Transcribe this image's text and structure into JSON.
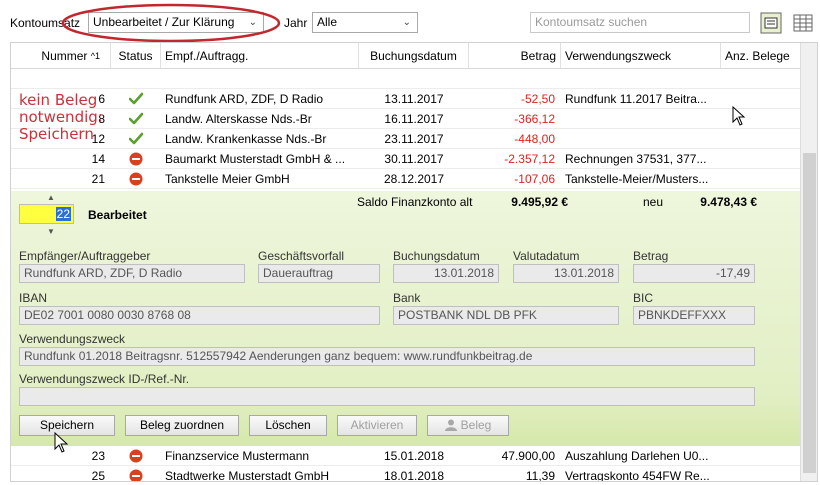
{
  "toolbar": {
    "kontoumsatz_label": "Kontoumsatz",
    "kontoumsatz_value": "Unbearbeitet / Zur Klärung",
    "jahr_label": "Jahr",
    "jahr_value": "Alle",
    "search_placeholder": "Kontoumsatz suchen"
  },
  "columns": {
    "nummer": "Nummer",
    "sort_indicator": "^1",
    "status": "Status",
    "empf": "Empf./Auftragg.",
    "datum": "Buchungsdatum",
    "betrag": "Betrag",
    "zweck": "Verwendungszweck",
    "belege": "Anz. Belege"
  },
  "rows_top": [
    {
      "nummer": "6",
      "status": "ok",
      "empf": "Rundfunk ARD, ZDF, D Radio",
      "datum": "13.11.2017",
      "betrag": "-52,50",
      "zweck": "Rundfunk 11.2017 Beitra..."
    },
    {
      "nummer": "8",
      "status": "ok",
      "empf": "Landw. Alterskasse Nds.-Br",
      "datum": "16.11.2017",
      "betrag": "-366,12",
      "zweck": ""
    },
    {
      "nummer": "12",
      "status": "ok",
      "empf": "Landw. Krankenkasse Nds.-Br",
      "datum": "23.11.2017",
      "betrag": "-448,00",
      "zweck": ""
    },
    {
      "nummer": "14",
      "status": "no",
      "empf": "Baumarkt Musterstadt GmbH & ...",
      "datum": "30.11.2017",
      "betrag": "-2.357,12",
      "zweck": "Rechnungen 37531, 377..."
    },
    {
      "nummer": "21",
      "status": "no",
      "empf": "Tankstelle Meier GmbH",
      "datum": "28.12.2017",
      "betrag": "-107,06",
      "zweck": "Tankstelle-Meier/Musters..."
    }
  ],
  "annotation": [
    "kein Beleg",
    "notwendig:",
    "Speichern"
  ],
  "panel": {
    "number": "22",
    "status_label": "Bearbeitet",
    "saldo_alt_label": "Saldo Finanzkonto alt",
    "saldo_alt_value": "9.495,92 €",
    "saldo_neu_label": "neu",
    "saldo_neu_value": "9.478,43 €",
    "empf_label": "Empfänger/Auftraggeber",
    "empf_value": "Rundfunk ARD, ZDF, D Radio",
    "geschaeft_label": "Geschäftsvorfall",
    "geschaeft_value": "Dauerauftrag",
    "buchung_label": "Buchungsdatum",
    "buchung_value": "13.01.2018",
    "valuta_label": "Valutadatum",
    "valuta_value": "13.01.2018",
    "betrag_label": "Betrag",
    "betrag_value": "-17,49",
    "iban_label": "IBAN",
    "iban_value": "DE02 7001 0080 0030 8768 08",
    "bank_label": "Bank",
    "bank_value": "POSTBANK NDL DB PFK",
    "bic_label": "BIC",
    "bic_value": "PBNKDEFFXXX",
    "zweck_label": "Verwendungszweck",
    "zweck_value": "Rundfunk 01.2018 Beitragsnr. 512557942 Aenderungen ganz bequem: www.rundfunkbeitrag.de",
    "zweckid_label": "Verwendungszweck ID-/Ref.-Nr.",
    "zweckid_value": ""
  },
  "buttons": {
    "speichern": "Speichern",
    "beleg_zuordnen": "Beleg zuordnen",
    "loeschen": "Löschen",
    "aktivieren": "Aktivieren",
    "beleg": "Beleg"
  },
  "rows_bottom": [
    {
      "nummer": "23",
      "status": "no",
      "empf": "Finanzservice Mustermann",
      "datum": "15.01.2018",
      "betrag": "47.900,00",
      "zweck": "Auszahlung Darlehen U0..."
    },
    {
      "nummer": "25",
      "status": "no",
      "empf": "Stadtwerke Musterstadt GmbH",
      "datum": "18.01.2018",
      "betrag": "11,39",
      "zweck": "Vertragskonto 454FW Re..."
    }
  ],
  "colors": {
    "negative": "#e02020",
    "ok": "#5aa02c",
    "no": "#d9411e",
    "highlight": "#ffff40",
    "annotation": "#c8323a"
  }
}
